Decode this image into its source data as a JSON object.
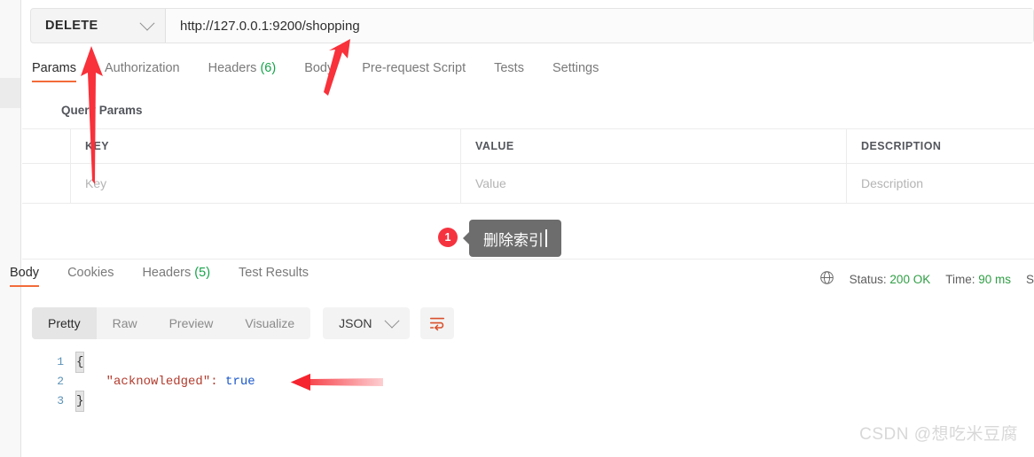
{
  "request": {
    "method": "DELETE",
    "method_icon": "chevron-down-icon",
    "url": "http://127.0.0.1:9200/shopping",
    "tabs": [
      {
        "label": "Params",
        "count": "",
        "active": true
      },
      {
        "label": "Authorization",
        "count": "",
        "active": false
      },
      {
        "label": "Headers",
        "count": "(6)",
        "active": false
      },
      {
        "label": "Body",
        "count": "",
        "active": false
      },
      {
        "label": "Pre-request Script",
        "count": "",
        "active": false
      },
      {
        "label": "Tests",
        "count": "",
        "active": false
      },
      {
        "label": "Settings",
        "count": "",
        "active": false
      }
    ]
  },
  "query_params": {
    "title": "Query Params",
    "columns": [
      "KEY",
      "VALUE",
      "DESCRIPTION"
    ],
    "rows": [
      {
        "key": "Key",
        "value": "Value",
        "description": "Description"
      }
    ]
  },
  "annotation": {
    "badge_number": "1",
    "tooltip_text": "删除索引"
  },
  "response": {
    "tabs": [
      {
        "label": "Body",
        "count": "",
        "active": true
      },
      {
        "label": "Cookies",
        "count": "",
        "active": false
      },
      {
        "label": "Headers",
        "count": "(5)",
        "active": false
      },
      {
        "label": "Test Results",
        "count": "",
        "active": false
      }
    ],
    "meta": {
      "globe_icon": "globe-icon",
      "status_label": "Status:",
      "status_value": "200 OK",
      "time_label": "Time:",
      "time_value": "90 ms",
      "size_label": "S"
    },
    "view_modes": [
      {
        "label": "Pretty",
        "active": true
      },
      {
        "label": "Raw",
        "active": false
      },
      {
        "label": "Preview",
        "active": false
      },
      {
        "label": "Visualize",
        "active": false
      }
    ],
    "format": {
      "label": "JSON",
      "icon": "chevron-down-icon"
    },
    "wrap_icon": "word-wrap-icon",
    "code": [
      {
        "num": "1",
        "open_brace": "{",
        "text": "",
        "value": ""
      },
      {
        "num": "2",
        "open_brace": "",
        "text": "\"acknowledged\":",
        "value": "true"
      },
      {
        "num": "3",
        "open_brace": "}",
        "text": "",
        "value": ""
      }
    ]
  },
  "watermark": "CSDN @想吃米豆腐",
  "colors": {
    "accent": "#f26b3a",
    "success": "#2f9e44",
    "annotation_red": "#f5333f",
    "tooltip_bg": "#6d6d6d"
  }
}
